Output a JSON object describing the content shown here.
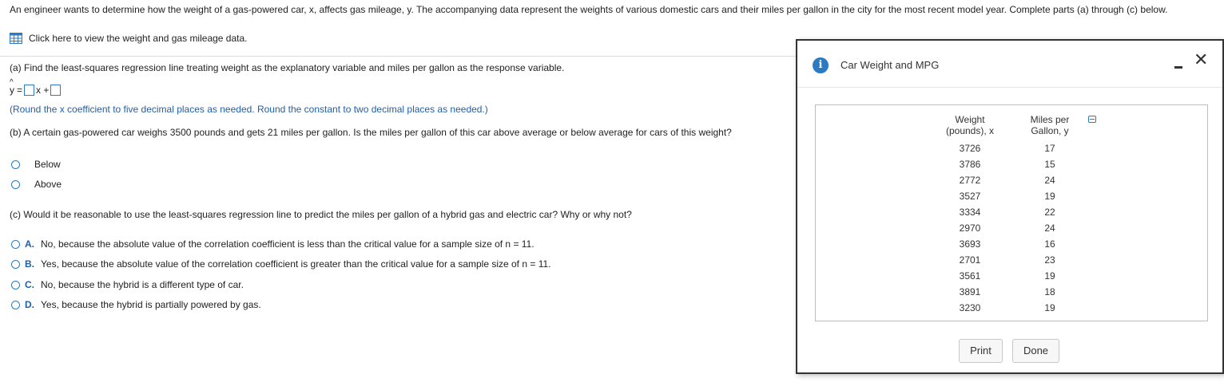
{
  "intro": "An engineer wants to determine how the weight of a gas-powered car, x, affects gas mileage, y. The accompanying data represent the weights of various domestic cars and their miles per gallon in the city for the most recent model year. Complete parts (a) through (c) below.",
  "data_link": "Click here to view the weight and gas mileage data.",
  "part_a": {
    "question": "(a) Find the least-squares regression line treating weight as the explanatory variable and miles per gallon as the response variable.",
    "y_hat": "y",
    "equals": "=",
    "x_plus": "x +",
    "hint": "(Round the x coefficient to five decimal places as needed. Round the constant to two decimal places as needed.)"
  },
  "part_b": {
    "question": "(b) A certain gas-powered car weighs 3500 pounds and gets 21 miles per gallon. Is the miles per gallon of this car above average or below average for cars of this weight?",
    "options": [
      "Below",
      "Above"
    ]
  },
  "part_c": {
    "question": "(c) Would it be reasonable to use the least-squares regression line to predict the miles per gallon of a hybrid gas and electric car? Why or why not?",
    "options": [
      {
        "letter": "A.",
        "text": "No, because the absolute value of the correlation coefficient is less than the critical value for a sample size of n = 11."
      },
      {
        "letter": "B.",
        "text": "Yes, because the absolute value of the correlation coefficient is greater than the critical value for a sample size of n = 11."
      },
      {
        "letter": "C.",
        "text": "No, because the hybrid is a different type of car."
      },
      {
        "letter": "D.",
        "text": "Yes, because the hybrid is partially powered by gas."
      }
    ]
  },
  "dialog": {
    "title": "Car Weight and MPG",
    "col1_line1": "Weight",
    "col1_line2": "(pounds), x",
    "col2_line1": "Miles per",
    "col2_line2": "Gallon, y",
    "rows": [
      {
        "weight": "3726",
        "mpg": "17"
      },
      {
        "weight": "3786",
        "mpg": "15"
      },
      {
        "weight": "2772",
        "mpg": "24"
      },
      {
        "weight": "3527",
        "mpg": "19"
      },
      {
        "weight": "3334",
        "mpg": "22"
      },
      {
        "weight": "2970",
        "mpg": "24"
      },
      {
        "weight": "3693",
        "mpg": "16"
      },
      {
        "weight": "2701",
        "mpg": "23"
      },
      {
        "weight": "3561",
        "mpg": "19"
      },
      {
        "weight": "3891",
        "mpg": "18"
      },
      {
        "weight": "3230",
        "mpg": "19"
      }
    ],
    "print_label": "Print",
    "done_label": "Done"
  },
  "colors": {
    "accent": "#2a7bc4",
    "hint": "#1f5fa6"
  }
}
